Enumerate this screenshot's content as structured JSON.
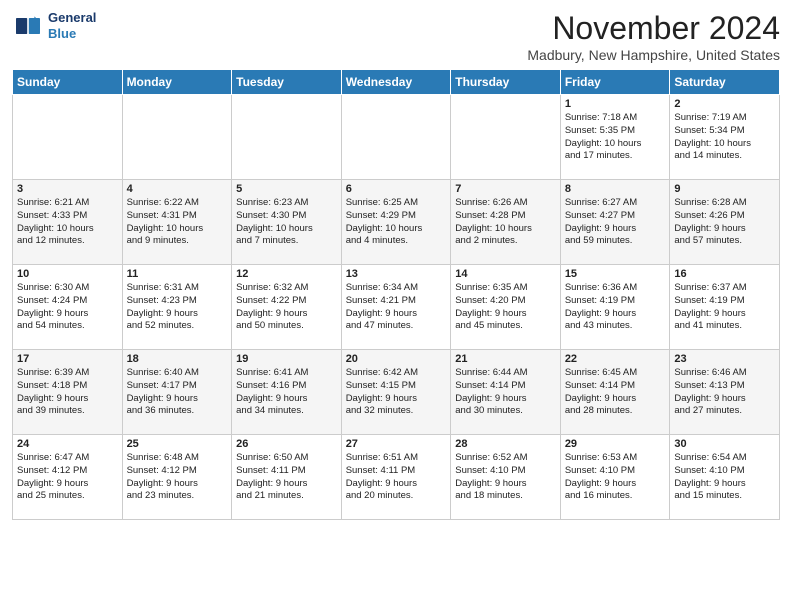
{
  "header": {
    "logo_line1": "General",
    "logo_line2": "Blue",
    "month": "November 2024",
    "location": "Madbury, New Hampshire, United States"
  },
  "weekdays": [
    "Sunday",
    "Monday",
    "Tuesday",
    "Wednesday",
    "Thursday",
    "Friday",
    "Saturday"
  ],
  "weeks": [
    [
      {
        "day": "",
        "info": ""
      },
      {
        "day": "",
        "info": ""
      },
      {
        "day": "",
        "info": ""
      },
      {
        "day": "",
        "info": ""
      },
      {
        "day": "",
        "info": ""
      },
      {
        "day": "1",
        "info": "Sunrise: 7:18 AM\nSunset: 5:35 PM\nDaylight: 10 hours\nand 17 minutes."
      },
      {
        "day": "2",
        "info": "Sunrise: 7:19 AM\nSunset: 5:34 PM\nDaylight: 10 hours\nand 14 minutes."
      }
    ],
    [
      {
        "day": "3",
        "info": "Sunrise: 6:21 AM\nSunset: 4:33 PM\nDaylight: 10 hours\nand 12 minutes."
      },
      {
        "day": "4",
        "info": "Sunrise: 6:22 AM\nSunset: 4:31 PM\nDaylight: 10 hours\nand 9 minutes."
      },
      {
        "day": "5",
        "info": "Sunrise: 6:23 AM\nSunset: 4:30 PM\nDaylight: 10 hours\nand 7 minutes."
      },
      {
        "day": "6",
        "info": "Sunrise: 6:25 AM\nSunset: 4:29 PM\nDaylight: 10 hours\nand 4 minutes."
      },
      {
        "day": "7",
        "info": "Sunrise: 6:26 AM\nSunset: 4:28 PM\nDaylight: 10 hours\nand 2 minutes."
      },
      {
        "day": "8",
        "info": "Sunrise: 6:27 AM\nSunset: 4:27 PM\nDaylight: 9 hours\nand 59 minutes."
      },
      {
        "day": "9",
        "info": "Sunrise: 6:28 AM\nSunset: 4:26 PM\nDaylight: 9 hours\nand 57 minutes."
      }
    ],
    [
      {
        "day": "10",
        "info": "Sunrise: 6:30 AM\nSunset: 4:24 PM\nDaylight: 9 hours\nand 54 minutes."
      },
      {
        "day": "11",
        "info": "Sunrise: 6:31 AM\nSunset: 4:23 PM\nDaylight: 9 hours\nand 52 minutes."
      },
      {
        "day": "12",
        "info": "Sunrise: 6:32 AM\nSunset: 4:22 PM\nDaylight: 9 hours\nand 50 minutes."
      },
      {
        "day": "13",
        "info": "Sunrise: 6:34 AM\nSunset: 4:21 PM\nDaylight: 9 hours\nand 47 minutes."
      },
      {
        "day": "14",
        "info": "Sunrise: 6:35 AM\nSunset: 4:20 PM\nDaylight: 9 hours\nand 45 minutes."
      },
      {
        "day": "15",
        "info": "Sunrise: 6:36 AM\nSunset: 4:19 PM\nDaylight: 9 hours\nand 43 minutes."
      },
      {
        "day": "16",
        "info": "Sunrise: 6:37 AM\nSunset: 4:19 PM\nDaylight: 9 hours\nand 41 minutes."
      }
    ],
    [
      {
        "day": "17",
        "info": "Sunrise: 6:39 AM\nSunset: 4:18 PM\nDaylight: 9 hours\nand 39 minutes."
      },
      {
        "day": "18",
        "info": "Sunrise: 6:40 AM\nSunset: 4:17 PM\nDaylight: 9 hours\nand 36 minutes."
      },
      {
        "day": "19",
        "info": "Sunrise: 6:41 AM\nSunset: 4:16 PM\nDaylight: 9 hours\nand 34 minutes."
      },
      {
        "day": "20",
        "info": "Sunrise: 6:42 AM\nSunset: 4:15 PM\nDaylight: 9 hours\nand 32 minutes."
      },
      {
        "day": "21",
        "info": "Sunrise: 6:44 AM\nSunset: 4:14 PM\nDaylight: 9 hours\nand 30 minutes."
      },
      {
        "day": "22",
        "info": "Sunrise: 6:45 AM\nSunset: 4:14 PM\nDaylight: 9 hours\nand 28 minutes."
      },
      {
        "day": "23",
        "info": "Sunrise: 6:46 AM\nSunset: 4:13 PM\nDaylight: 9 hours\nand 27 minutes."
      }
    ],
    [
      {
        "day": "24",
        "info": "Sunrise: 6:47 AM\nSunset: 4:12 PM\nDaylight: 9 hours\nand 25 minutes."
      },
      {
        "day": "25",
        "info": "Sunrise: 6:48 AM\nSunset: 4:12 PM\nDaylight: 9 hours\nand 23 minutes."
      },
      {
        "day": "26",
        "info": "Sunrise: 6:50 AM\nSunset: 4:11 PM\nDaylight: 9 hours\nand 21 minutes."
      },
      {
        "day": "27",
        "info": "Sunrise: 6:51 AM\nSunset: 4:11 PM\nDaylight: 9 hours\nand 20 minutes."
      },
      {
        "day": "28",
        "info": "Sunrise: 6:52 AM\nSunset: 4:10 PM\nDaylight: 9 hours\nand 18 minutes."
      },
      {
        "day": "29",
        "info": "Sunrise: 6:53 AM\nSunset: 4:10 PM\nDaylight: 9 hours\nand 16 minutes."
      },
      {
        "day": "30",
        "info": "Sunrise: 6:54 AM\nSunset: 4:10 PM\nDaylight: 9 hours\nand 15 minutes."
      }
    ]
  ]
}
